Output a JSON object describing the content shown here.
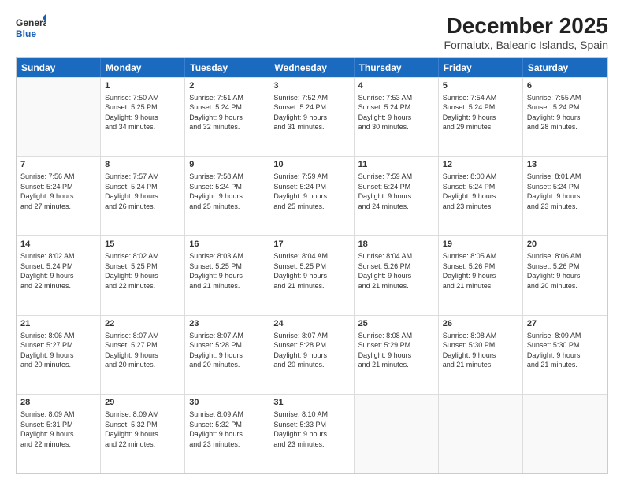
{
  "logo": {
    "line1": "General",
    "line2": "Blue"
  },
  "title": "December 2025",
  "subtitle": "Fornalutx, Balearic Islands, Spain",
  "header_days": [
    "Sunday",
    "Monday",
    "Tuesday",
    "Wednesday",
    "Thursday",
    "Friday",
    "Saturday"
  ],
  "weeks": [
    [
      {
        "day": "",
        "info": ""
      },
      {
        "day": "1",
        "info": "Sunrise: 7:50 AM\nSunset: 5:25 PM\nDaylight: 9 hours\nand 34 minutes."
      },
      {
        "day": "2",
        "info": "Sunrise: 7:51 AM\nSunset: 5:24 PM\nDaylight: 9 hours\nand 32 minutes."
      },
      {
        "day": "3",
        "info": "Sunrise: 7:52 AM\nSunset: 5:24 PM\nDaylight: 9 hours\nand 31 minutes."
      },
      {
        "day": "4",
        "info": "Sunrise: 7:53 AM\nSunset: 5:24 PM\nDaylight: 9 hours\nand 30 minutes."
      },
      {
        "day": "5",
        "info": "Sunrise: 7:54 AM\nSunset: 5:24 PM\nDaylight: 9 hours\nand 29 minutes."
      },
      {
        "day": "6",
        "info": "Sunrise: 7:55 AM\nSunset: 5:24 PM\nDaylight: 9 hours\nand 28 minutes."
      }
    ],
    [
      {
        "day": "7",
        "info": "Sunrise: 7:56 AM\nSunset: 5:24 PM\nDaylight: 9 hours\nand 27 minutes."
      },
      {
        "day": "8",
        "info": "Sunrise: 7:57 AM\nSunset: 5:24 PM\nDaylight: 9 hours\nand 26 minutes."
      },
      {
        "day": "9",
        "info": "Sunrise: 7:58 AM\nSunset: 5:24 PM\nDaylight: 9 hours\nand 25 minutes."
      },
      {
        "day": "10",
        "info": "Sunrise: 7:59 AM\nSunset: 5:24 PM\nDaylight: 9 hours\nand 25 minutes."
      },
      {
        "day": "11",
        "info": "Sunrise: 7:59 AM\nSunset: 5:24 PM\nDaylight: 9 hours\nand 24 minutes."
      },
      {
        "day": "12",
        "info": "Sunrise: 8:00 AM\nSunset: 5:24 PM\nDaylight: 9 hours\nand 23 minutes."
      },
      {
        "day": "13",
        "info": "Sunrise: 8:01 AM\nSunset: 5:24 PM\nDaylight: 9 hours\nand 23 minutes."
      }
    ],
    [
      {
        "day": "14",
        "info": "Sunrise: 8:02 AM\nSunset: 5:24 PM\nDaylight: 9 hours\nand 22 minutes."
      },
      {
        "day": "15",
        "info": "Sunrise: 8:02 AM\nSunset: 5:25 PM\nDaylight: 9 hours\nand 22 minutes."
      },
      {
        "day": "16",
        "info": "Sunrise: 8:03 AM\nSunset: 5:25 PM\nDaylight: 9 hours\nand 21 minutes."
      },
      {
        "day": "17",
        "info": "Sunrise: 8:04 AM\nSunset: 5:25 PM\nDaylight: 9 hours\nand 21 minutes."
      },
      {
        "day": "18",
        "info": "Sunrise: 8:04 AM\nSunset: 5:26 PM\nDaylight: 9 hours\nand 21 minutes."
      },
      {
        "day": "19",
        "info": "Sunrise: 8:05 AM\nSunset: 5:26 PM\nDaylight: 9 hours\nand 21 minutes."
      },
      {
        "day": "20",
        "info": "Sunrise: 8:06 AM\nSunset: 5:26 PM\nDaylight: 9 hours\nand 20 minutes."
      }
    ],
    [
      {
        "day": "21",
        "info": "Sunrise: 8:06 AM\nSunset: 5:27 PM\nDaylight: 9 hours\nand 20 minutes."
      },
      {
        "day": "22",
        "info": "Sunrise: 8:07 AM\nSunset: 5:27 PM\nDaylight: 9 hours\nand 20 minutes."
      },
      {
        "day": "23",
        "info": "Sunrise: 8:07 AM\nSunset: 5:28 PM\nDaylight: 9 hours\nand 20 minutes."
      },
      {
        "day": "24",
        "info": "Sunrise: 8:07 AM\nSunset: 5:28 PM\nDaylight: 9 hours\nand 20 minutes."
      },
      {
        "day": "25",
        "info": "Sunrise: 8:08 AM\nSunset: 5:29 PM\nDaylight: 9 hours\nand 21 minutes."
      },
      {
        "day": "26",
        "info": "Sunrise: 8:08 AM\nSunset: 5:30 PM\nDaylight: 9 hours\nand 21 minutes."
      },
      {
        "day": "27",
        "info": "Sunrise: 8:09 AM\nSunset: 5:30 PM\nDaylight: 9 hours\nand 21 minutes."
      }
    ],
    [
      {
        "day": "28",
        "info": "Sunrise: 8:09 AM\nSunset: 5:31 PM\nDaylight: 9 hours\nand 22 minutes."
      },
      {
        "day": "29",
        "info": "Sunrise: 8:09 AM\nSunset: 5:32 PM\nDaylight: 9 hours\nand 22 minutes."
      },
      {
        "day": "30",
        "info": "Sunrise: 8:09 AM\nSunset: 5:32 PM\nDaylight: 9 hours\nand 23 minutes."
      },
      {
        "day": "31",
        "info": "Sunrise: 8:10 AM\nSunset: 5:33 PM\nDaylight: 9 hours\nand 23 minutes."
      },
      {
        "day": "",
        "info": ""
      },
      {
        "day": "",
        "info": ""
      },
      {
        "day": "",
        "info": ""
      }
    ]
  ]
}
